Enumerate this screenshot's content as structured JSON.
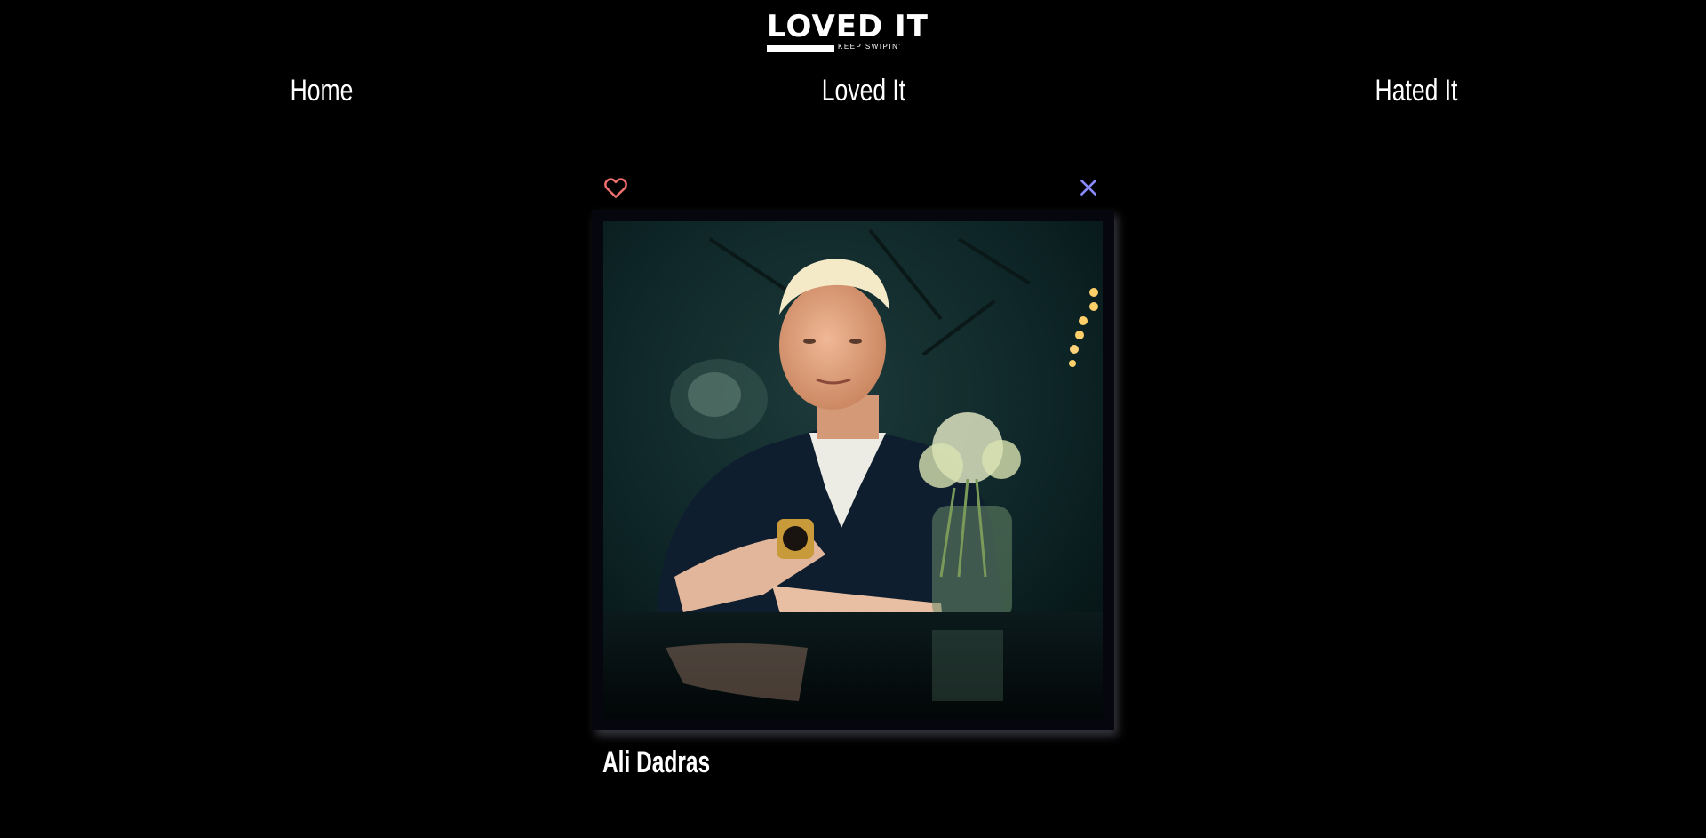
{
  "brand": {
    "title": "LOVED IT",
    "tagline": "KEEP SWIPIN'"
  },
  "nav": {
    "home": "Home",
    "loved": "Loved It",
    "hated": "Hated It"
  },
  "card": {
    "name": "Ali Dadras",
    "love_icon": "heart-icon",
    "hate_icon": "close-icon"
  },
  "colors": {
    "background": "#000000",
    "heart": "#f07070",
    "close": "#8a8aff",
    "card_bg": "#06060f"
  }
}
